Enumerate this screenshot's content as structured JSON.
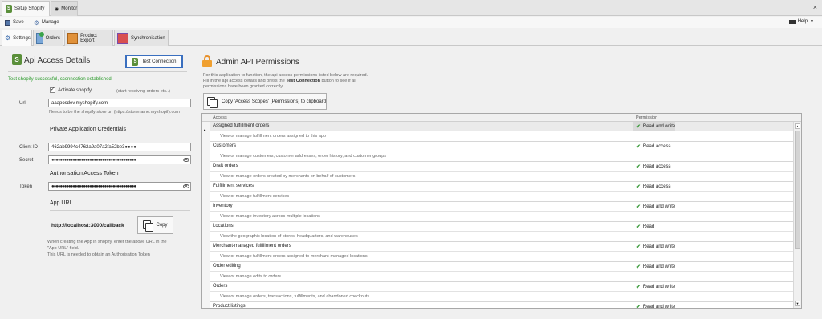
{
  "top_tabs": [
    {
      "label": "Setup Shopify",
      "active": true
    },
    {
      "label": "Monitor",
      "active": false
    }
  ],
  "toolbar": {
    "save": "Save",
    "manage": "Manage",
    "help": "Help"
  },
  "sub_tabs": [
    {
      "label": "Settings"
    },
    {
      "label": "Orders"
    },
    {
      "label": "Product Export"
    },
    {
      "label": "Synchronisation"
    }
  ],
  "api_access": {
    "title": "Api Access Details",
    "test_button": "Test Connection",
    "status": "Test shopify successful, cconnection established",
    "activate_label": "Activate shopify",
    "activate_hint": "(start receiving orders etc..)",
    "url_label": "Url",
    "url_value": "aaaposdev.myshopify.com",
    "url_hint": "Needs to be the shopify store url (https://storename.myshopify.com",
    "private_title": "Private Application Credentials",
    "client_id_label": "Client ID",
    "client_id_value": "462ab9994c4762a9a07a2fa52be3●●●●",
    "secret_label": "Secret",
    "secret_value": "●●●●●●●●●●●●●●●●●●●●●●●●●●●●●●●●●●●●●●●●",
    "auth_title": "Authorisation Access Token",
    "token_label": "Token",
    "token_value": "●●●●●●●●●●●●●●●●●●●●●●●●●●●●●●●●●●●●●●●●",
    "app_url_title": "App URL",
    "app_url_value": "http://localhost:3000/callback",
    "copy_button": "Copy",
    "footer_line1": "When creating the App in shopify, enter the above URL in the",
    "footer_line2": "\"App URL\" field.",
    "footer_line3": "This URL is needed to obtain an Authorisation Token"
  },
  "admin_api": {
    "title": "Admin API Permissions",
    "desc1": "For this application to function, the api access permissions listed below are required.",
    "desc2_pre": "Fill in the api access details and press the ",
    "desc2_bold": "Test Connection",
    "desc2_post": " button to see if all",
    "desc3": "permissions have been granted correctly.",
    "copy_scopes_button": "Copy 'Access Scopes' (Permissions) to clipboard",
    "col_access": "Access",
    "col_permission": "Permission",
    "rows": [
      {
        "name": "Assigned fulfillment orders",
        "perm": "Read and write",
        "desc": "View or manage fulfillment orders assigned to this app"
      },
      {
        "name": "Customers",
        "perm": "Read access",
        "desc": "View or manage customers, customer addresses, order history, and customer groups"
      },
      {
        "name": "Draft orders",
        "perm": "Read access",
        "desc": "View or manage orders created by merchants on behalf of customers"
      },
      {
        "name": "Fulfillment services",
        "perm": "Read access",
        "desc": "View or manage fulfillment services"
      },
      {
        "name": "Inventory",
        "perm": "Read and write",
        "desc": "View or manage inventory across multiple locations"
      },
      {
        "name": "Locations",
        "perm": "Read",
        "desc": "View the geographic location of stores, headquarters, and warehouses"
      },
      {
        "name": "Merchant-managed fulfillment orders",
        "perm": "Read and write",
        "desc": "View or manage fulfillment orders assigned to merchant-managed locations"
      },
      {
        "name": "Order editing",
        "perm": "Read and write",
        "desc": "View or manage edits to orders"
      },
      {
        "name": "Orders",
        "perm": "Read and write",
        "desc": "View or manage orders, transactions, fulfillments, and abandoned checkouts"
      },
      {
        "name": "Product listings",
        "perm": "Read and write",
        "desc": ""
      }
    ]
  }
}
